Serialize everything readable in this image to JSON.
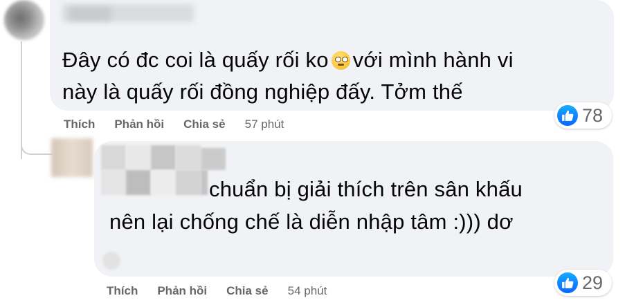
{
  "comments": [
    {
      "text_line1": "Đây có đc coi là quấy rối ko",
      "emoji": "face-with-rolling-eyes-icon",
      "text_line1_rest": "với mình hành vi",
      "text_line2": "này là quấy rối đồng nghiệp đấy. Tởm thế",
      "actions": {
        "like": "Thích",
        "reply": "Phản hồi",
        "share": "Chia sẻ",
        "time": "57 phút"
      },
      "reactions": {
        "icon": "like-icon",
        "count": "78"
      }
    },
    {
      "text_line1": "chuẩn bị giải thích trên sân khấu",
      "text_line2": "nên lại chống chế là diễn nhập tâm :))) dơ",
      "actions": {
        "like": "Thích",
        "reply": "Phản hồi",
        "share": "Chia sẻ",
        "time": "54 phút"
      },
      "reactions": {
        "icon": "like-icon",
        "count": "29"
      }
    }
  ],
  "colors": {
    "bubble": "#f0f2f5",
    "action_text": "#65676b",
    "like_blue": "#0866ff"
  }
}
